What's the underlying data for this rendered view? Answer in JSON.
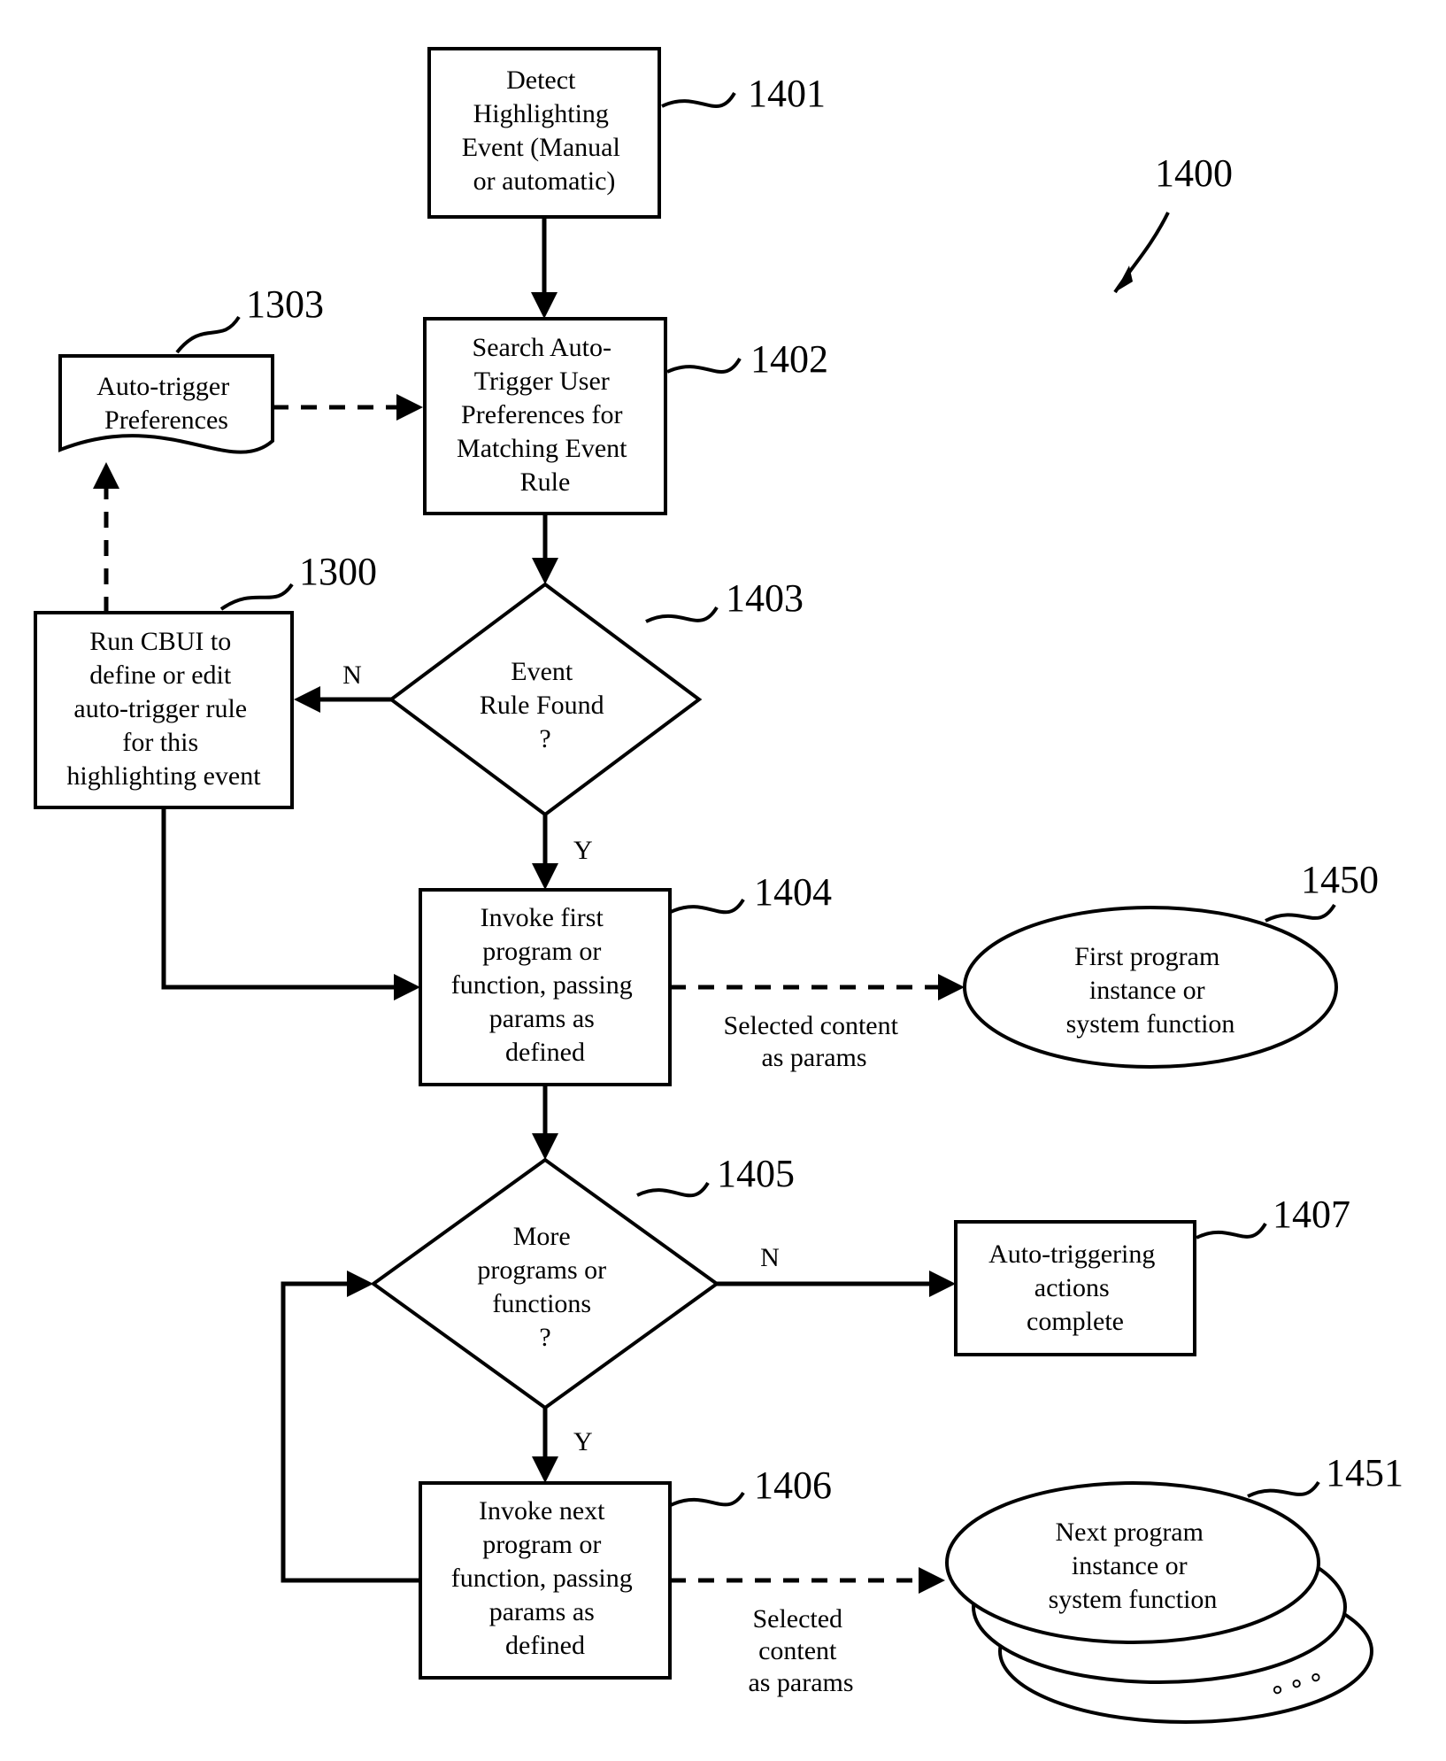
{
  "figure_label": "1400",
  "nodes": {
    "n1401": {
      "ref": "1401",
      "lines": [
        "Detect",
        "Highlighting",
        "Event (Manual",
        "or automatic)"
      ]
    },
    "n1402": {
      "ref": "1402",
      "lines": [
        "Search Auto-",
        "Trigger User",
        "Preferences for",
        "Matching Event",
        "Rule"
      ]
    },
    "n1303": {
      "ref": "1303",
      "lines": [
        "Auto-trigger",
        "Preferences"
      ]
    },
    "n1403": {
      "ref": "1403",
      "lines": [
        "Event",
        "Rule Found",
        "?"
      ]
    },
    "n1300": {
      "ref": "1300",
      "lines": [
        "Run CBUI to",
        "define or edit",
        "auto-trigger rule",
        "for this",
        "highlighting event"
      ]
    },
    "n1404": {
      "ref": "1404",
      "lines": [
        "Invoke first",
        "program or",
        "function, passing",
        "params as",
        "defined"
      ]
    },
    "n1405": {
      "ref": "1405",
      "lines": [
        "More",
        "programs or",
        "functions",
        "?"
      ]
    },
    "n1406": {
      "ref": "1406",
      "lines": [
        "Invoke next",
        "program or",
        "function, passing",
        "params as",
        "defined"
      ]
    },
    "n1407": {
      "ref": "1407",
      "lines": [
        "Auto-triggering",
        "actions",
        "complete"
      ]
    },
    "n1450": {
      "ref": "1450",
      "lines": [
        "First program",
        "instance or",
        "system function"
      ]
    },
    "n1451": {
      "ref": "1451",
      "lines": [
        "Next program",
        "instance or",
        "system function"
      ]
    }
  },
  "edges": {
    "e1403_n": "N",
    "e1403_y": "Y",
    "e1405_n": "N",
    "e1405_y": "Y",
    "e1404_1450": {
      "lines": [
        "Selected content",
        "as params"
      ]
    },
    "e1406_1451": {
      "lines": [
        "Selected",
        "content",
        "as params"
      ]
    }
  },
  "misc": {
    "ellipsis_dots": "∘∘∘"
  }
}
